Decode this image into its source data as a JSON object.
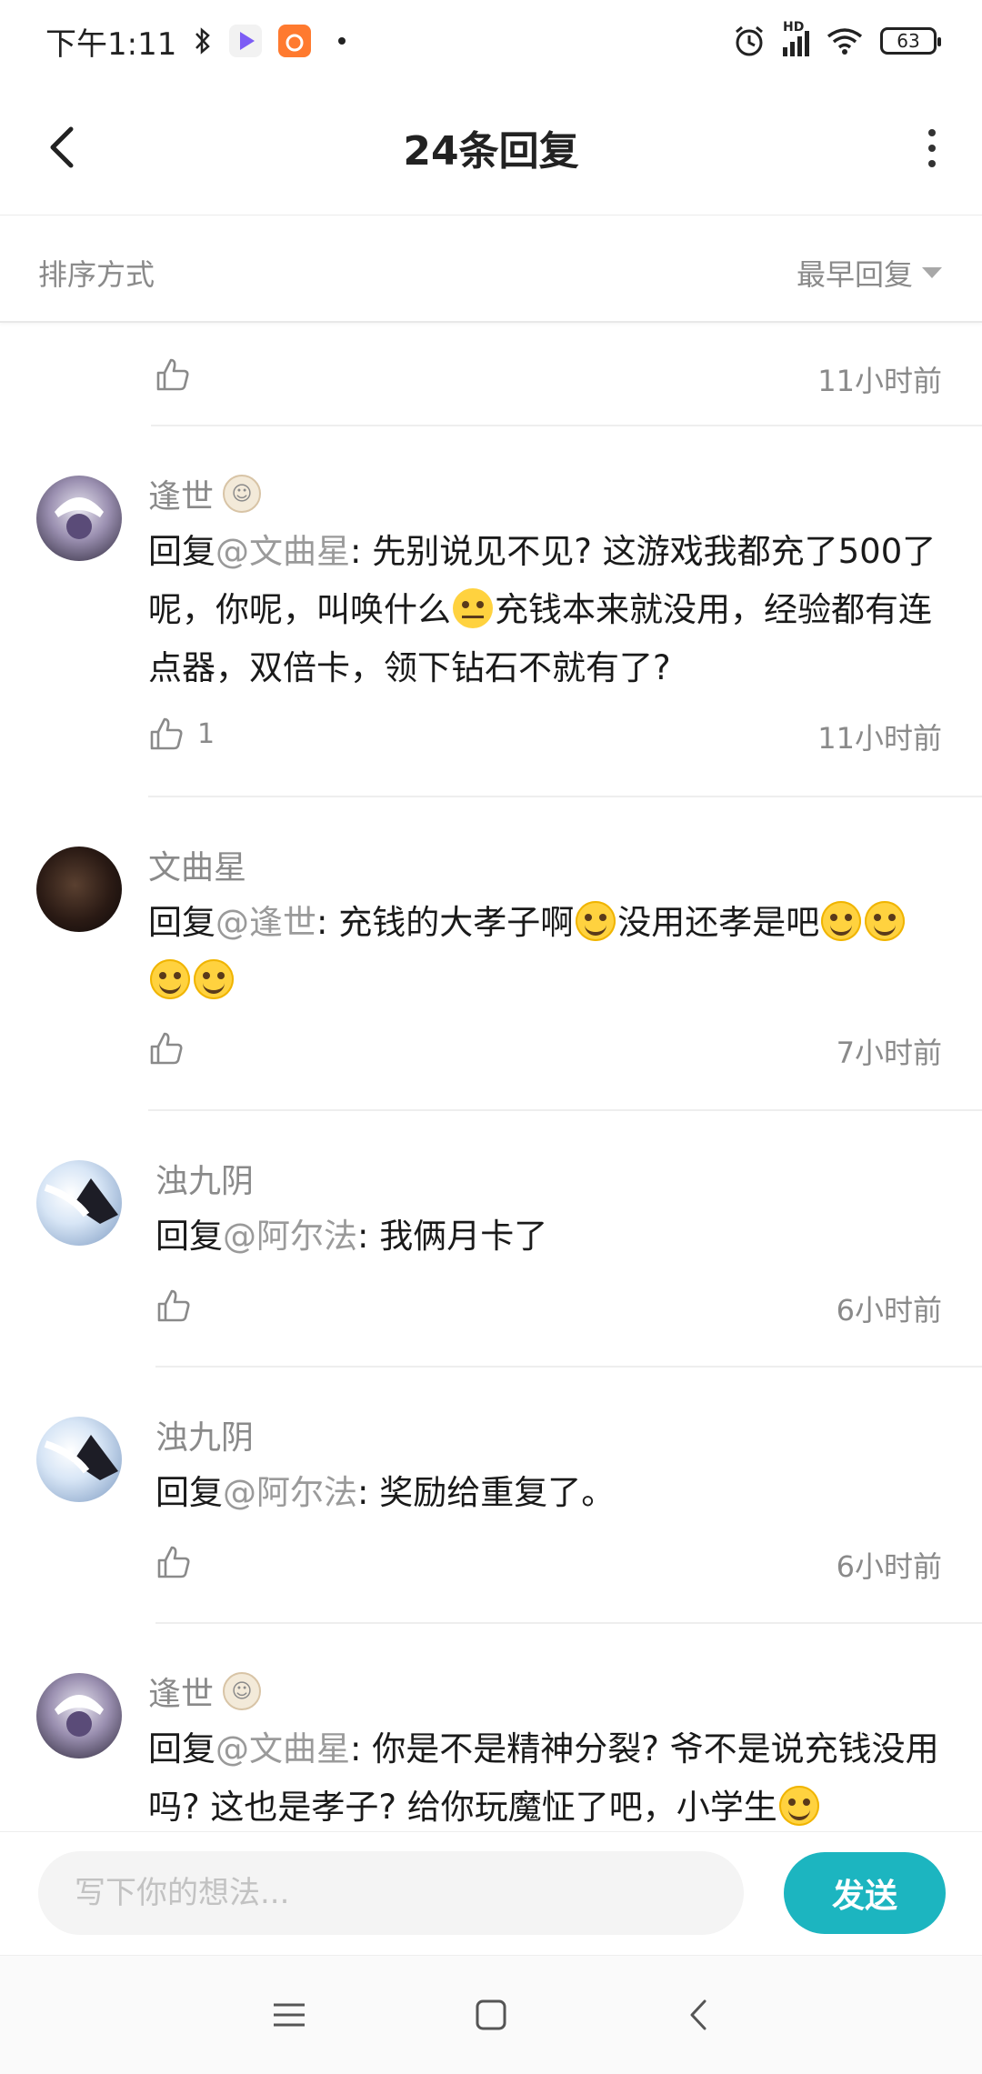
{
  "status_bar": {
    "time": "下午1:11",
    "network": "HD",
    "battery": "63"
  },
  "header": {
    "title": "24条回复"
  },
  "sort": {
    "label": "排序方式",
    "value": "最早回复"
  },
  "replies": [
    {
      "time": "11小时前"
    },
    {
      "name": "逢世",
      "reply_prefix": "回复",
      "mention": "@文曲星",
      "text_a": ": 先别说见不见? 这游戏我都充了500了呢，你呢，叫唤什么",
      "text_b": "充钱本来就没用，经验都有连点器，双倍卡，领下钻石不就有了?",
      "likes": "1",
      "time": "11小时前"
    },
    {
      "name": "文曲星",
      "reply_prefix": "回复",
      "mention": "@逢世",
      "text_a": ": 充钱的大孝子啊",
      "text_b": "没用还孝是吧",
      "time": "7小时前"
    },
    {
      "name": "浊九阴",
      "reply_prefix": "回复",
      "mention": "@阿尔法",
      "text_a": ": 我俩月卡了",
      "time": "6小时前"
    },
    {
      "name": "浊九阴",
      "reply_prefix": "回复",
      "mention": "@阿尔法",
      "text_a": ": 奖励给重复了。",
      "time": "6小时前"
    },
    {
      "name": "逢世",
      "reply_prefix": "回复",
      "mention": "@文曲星",
      "text_a": ": 你是不是精神分裂? 爷不是说充钱没用吗? 这也是孝子? 给你玩魔怔了吧，小学生"
    }
  ],
  "composer": {
    "placeholder": "写下你的想法...",
    "send_label": "发送"
  },
  "colors": {
    "accent": "#1cb5c0",
    "meta_text": "#8a8a8a"
  }
}
